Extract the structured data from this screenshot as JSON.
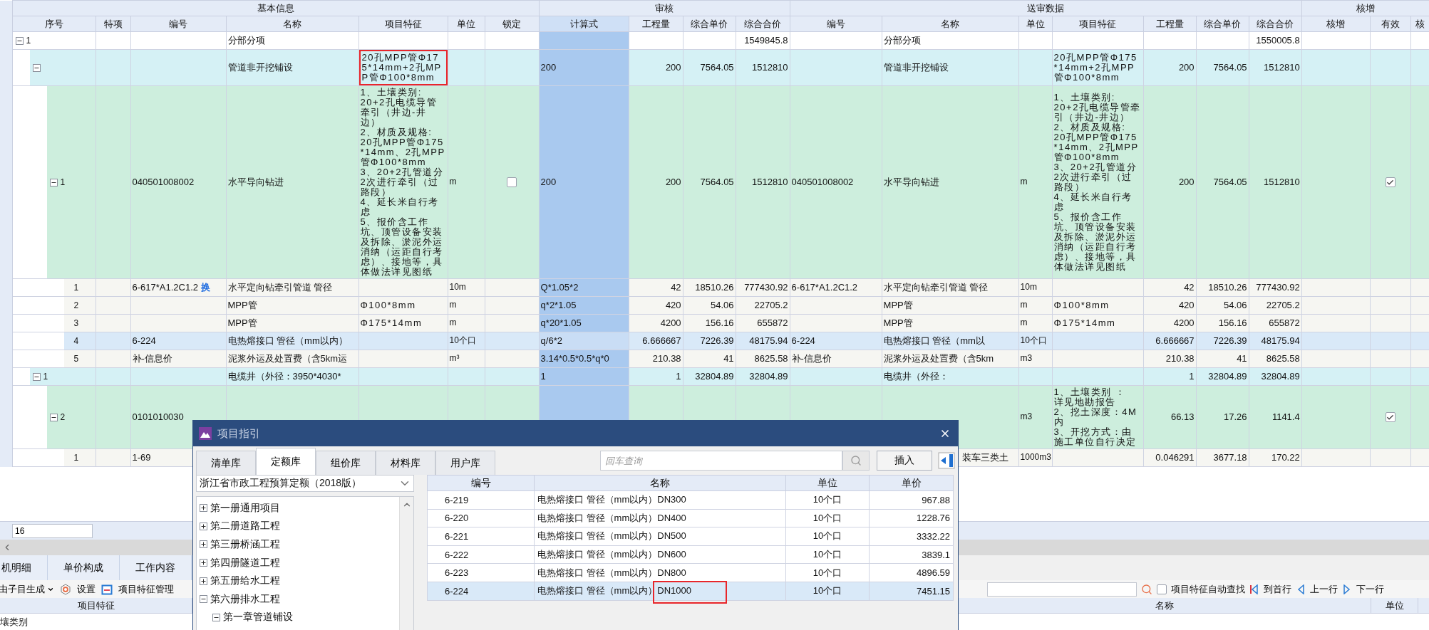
{
  "table": {
    "groups": [
      {
        "label": "基本信息",
        "columns": [
          {
            "label": "序号",
            "selected": false
          },
          {
            "label": "特项",
            "selected": false
          },
          {
            "label": "编号",
            "selected": false
          },
          {
            "label": "名称",
            "selected": false
          },
          {
            "label": "项目特征",
            "selected": false
          },
          {
            "label": "单位",
            "selected": false
          },
          {
            "label": "锁定",
            "selected": false
          }
        ]
      },
      {
        "label": "审核",
        "columns": [
          {
            "label": "计算式",
            "selected": true
          },
          {
            "label": "工程量",
            "selected": false
          },
          {
            "label": "综合单价",
            "selected": false
          },
          {
            "label": "综合合价",
            "selected": false
          }
        ]
      },
      {
        "label": "送审数据",
        "columns": [
          {
            "label": "编号",
            "selected": false
          },
          {
            "label": "名称",
            "selected": false
          },
          {
            "label": "单位",
            "selected": false
          },
          {
            "label": "项目特征",
            "selected": false
          },
          {
            "label": "工程量",
            "selected": false
          },
          {
            "label": "综合单价",
            "selected": false
          },
          {
            "label": "综合合价",
            "selected": false
          }
        ]
      },
      {
        "label": "核增",
        "columns": [
          {
            "label": "核增",
            "selected": false
          },
          {
            "label": "有效",
            "selected": false
          },
          {
            "label": "核",
            "selected": false
          }
        ]
      }
    ],
    "rows": [
      {
        "kind": "group",
        "seq": "1",
        "name": "分部分项",
        "total": "1549845.8",
        "s_name": "分部分项",
        "s_total": "1550005.8",
        "selected": false,
        "expanded": true,
        "children": [
          {
            "kind": "section",
            "name": "管道非开挖铺设",
            "feature": "20孔MPP管Φ175*14mm+2孔MPP管Φ100*8mm",
            "feature_marked": true,
            "formula": "200",
            "qty": "200",
            "price": "7564.05",
            "total": "1512810",
            "s_name": "管道非开挖铺设",
            "s_feature": "20孔MPP管Φ175*14mm+2孔MPP管Φ100*8mm",
            "s_qty": "200",
            "s_price": "7564.05",
            "s_total": "1512810",
            "selected": false,
            "expanded": true,
            "children": [
              {
                "kind": "item",
                "seq": "1",
                "code": "040501008002",
                "name": "水平导向钻进",
                "feature": "1、土壤类别:\n20+2孔电缆导管牵引（井边-井边）\n2、材质及规格:\n20孔MPP管Φ175*14mm、2孔MPP管Φ100*8mm\n3、20+2孔管道分2次进行牵引（过路段）\n4、延长米自行考虑\n5、报价含工作坑、顶管设备安装及拆除、淤泥外运消纳（运距自行考虑）、接地等，具体做法详见图纸",
                "unit": "m",
                "locked": false,
                "formula": "200",
                "qty": "200",
                "price": "7564.05",
                "total": "1512810",
                "s_code": "040501008002",
                "s_name": "水平导向钻进",
                "s_unit": "m",
                "s_feature": "1、土壤类别:\n20+2孔电缆导管牵引（井边-井边）\n2、材质及规格:\n20孔MPP管Φ175*14mm、2孔MPP管Φ100*8mm\n3、20+2孔管道分2次进行牵引（过路段）\n4、延长米自行考虑\n5、报价含工作坑、顶管设备安装及拆除、淤泥外运消纳（运距自行考虑）、接地等，具体做法详见图纸",
                "s_qty": "200",
                "s_price": "7564.05",
                "s_total": "1512810",
                "valid": true,
                "selected": false,
                "expanded": true,
                "children": [
                  {
                    "kind": "sub",
                    "seq": "1",
                    "code": "6-617*A1.2C1.2",
                    "flag": "换",
                    "name": "水平定向钻牵引管道 管径",
                    "unit": "10m",
                    "formula": "Q*1.05*2",
                    "qty": "42",
                    "price": "18510.26",
                    "total": "777430.92",
                    "s_code": "6-617*A1.2C1.2",
                    "s_name": "水平定向钻牵引管道 管径",
                    "s_unit": "10m",
                    "s_qty": "42",
                    "s_price": "18510.26",
                    "s_total": "777430.92",
                    "selected": false
                  },
                  {
                    "kind": "sub",
                    "seq": "2",
                    "name": "MPP管",
                    "feature": "Φ100*8mm",
                    "unit": "m",
                    "formula": "q*2*1.05",
                    "qty": "420",
                    "price": "54.06",
                    "total": "22705.2",
                    "s_name": "MPP管",
                    "s_unit": "m",
                    "s_feature": "Φ100*8mm",
                    "s_qty": "420",
                    "s_price": "54.06",
                    "s_total": "22705.2",
                    "selected": false
                  },
                  {
                    "kind": "sub",
                    "seq": "3",
                    "name": "MPP管",
                    "feature": "Φ175*14mm",
                    "unit": "m",
                    "formula": "q*20*1.05",
                    "qty": "4200",
                    "price": "156.16",
                    "total": "655872",
                    "s_name": "MPP管",
                    "s_unit": "m",
                    "s_feature": "Φ175*14mm",
                    "s_qty": "4200",
                    "s_price": "156.16",
                    "s_total": "655872",
                    "selected": false
                  },
                  {
                    "kind": "sub",
                    "seq": "4",
                    "code": "6-224",
                    "name": "电热熔接口 管径（mm以内）",
                    "unit": "10个口",
                    "formula": "q/6*2",
                    "qty": "6.666667",
                    "price": "7226.39",
                    "total": "48175.94",
                    "s_code": "6-224",
                    "s_name": "电热熔接口 管径（mm以",
                    "s_unit": "10个口",
                    "s_qty": "6.666667",
                    "s_price": "7226.39",
                    "s_total": "48175.94",
                    "selected": true
                  },
                  {
                    "kind": "sub",
                    "seq": "5",
                    "code": "补-信息价",
                    "name": "泥浆外运及处置费（含5km运",
                    "unit": "m³",
                    "formula": "3.14*0.5*0.5*q*0",
                    "qty": "210.38",
                    "price": "41",
                    "total": "8625.58",
                    "s_code": "补-信息价",
                    "s_name": "泥浆外运及处置费（含5km",
                    "s_unit": "m3",
                    "s_qty": "210.38",
                    "s_price": "41",
                    "s_total": "8625.58",
                    "selected": false
                  }
                ]
              }
            ]
          },
          {
            "kind": "section",
            "seq": "1",
            "name": "电缆井（外径：3950*4030*",
            "formula": "1",
            "qty": "1",
            "price": "32804.89",
            "total": "32804.89",
            "s_name": "电缆井（外径：",
            "s_qty": "1",
            "s_price": "32804.89",
            "s_total": "32804.89",
            "selected": false,
            "expanded": true,
            "children": [
              {
                "kind": "item",
                "seq": "2",
                "code": "0101010030",
                "s_unit": "m3",
                "s_feature": [
                  "1、土壤类别 ：",
                  "详见地勘报告",
                  "2、挖土深度：4M内",
                  "3、开挖方式：由施工单位自行决定"
                ],
                "s_qty": "66.13",
                "s_price": "17.26",
                "s_total": "1141.4",
                "valid": true,
                "selected": false,
                "expanded": true,
                "children": [
                  {
                    "kind": "sub",
                    "seq": "1",
                    "code": "1-69",
                    "s_name": "装车三类土",
                    "s_unit": "1000m3",
                    "s_qty": "0.046291",
                    "s_price": "3677.18",
                    "s_total": "170.22",
                    "selected": false
                  }
                ]
              }
            ]
          }
        ]
      }
    ]
  },
  "row_count_field": {
    "value": "16"
  },
  "bottom": {
    "tabs": [
      {
        "label": "机明细",
        "selected": false
      },
      {
        "label": "单价构成",
        "selected": false
      },
      {
        "label": "工作内容",
        "selected": false
      }
    ],
    "toolbar": {
      "generate": "由子目生成",
      "settings": "设置",
      "feature_manage": "项目特征管理",
      "auto_find": {
        "label": "项目特征自动查找",
        "checked": false
      },
      "first": "到首行",
      "prev": "上一行",
      "next": "下一行"
    },
    "left_header": "项目特征",
    "left_rows": [
      "壤类别"
    ],
    "right_columns": [
      "名称",
      "单位"
    ]
  },
  "dialog": {
    "title": "项目指引",
    "tabs": [
      {
        "label": "清单库",
        "selected": false
      },
      {
        "label": "定额库",
        "selected": true
      },
      {
        "label": "组价库",
        "selected": false
      },
      {
        "label": "材料库",
        "selected": false
      },
      {
        "label": "用户库",
        "selected": false
      }
    ],
    "search": {
      "placeholder": "回车查询"
    },
    "insert": "插入",
    "library": "浙江省市政工程预算定额（2018版）",
    "tree": [
      {
        "label": "第一册通用项目",
        "expanded": false
      },
      {
        "label": "第二册道路工程",
        "expanded": false
      },
      {
        "label": "第三册桥涵工程",
        "expanded": false
      },
      {
        "label": "第四册隧道工程",
        "expanded": false
      },
      {
        "label": "第五册给水工程",
        "expanded": false
      },
      {
        "label": "第六册排水工程",
        "expanded": true,
        "children": [
          {
            "label": "第一章管道铺设",
            "expanded": true
          }
        ]
      }
    ],
    "columns": [
      "编号",
      "名称",
      "单位",
      "单价"
    ],
    "rows": [
      {
        "code": "6-219",
        "name": "电热熔接口 管径（mm以内）DN300",
        "unit": "10个口",
        "price": "967.88",
        "selected": false,
        "marked": false
      },
      {
        "code": "6-220",
        "name": "电热熔接口 管径（mm以内）DN400",
        "unit": "10个口",
        "price": "1228.76",
        "selected": false,
        "marked": false
      },
      {
        "code": "6-221",
        "name": "电热熔接口 管径（mm以内）DN500",
        "unit": "10个口",
        "price": "3332.22",
        "selected": false,
        "marked": false
      },
      {
        "code": "6-222",
        "name": "电热熔接口 管径（mm以内）DN600",
        "unit": "10个口",
        "price": "3839.1",
        "selected": false,
        "marked": false
      },
      {
        "code": "6-223",
        "name": "电热熔接口 管径（mm以内）DN800",
        "unit": "10个口",
        "price": "4896.59",
        "selected": false,
        "marked": false
      },
      {
        "code": "6-224",
        "name": "电热熔接口 管径（mm以内）DN1000",
        "unit": "10个口",
        "price": "7451.15",
        "selected": true,
        "marked": true
      }
    ]
  }
}
